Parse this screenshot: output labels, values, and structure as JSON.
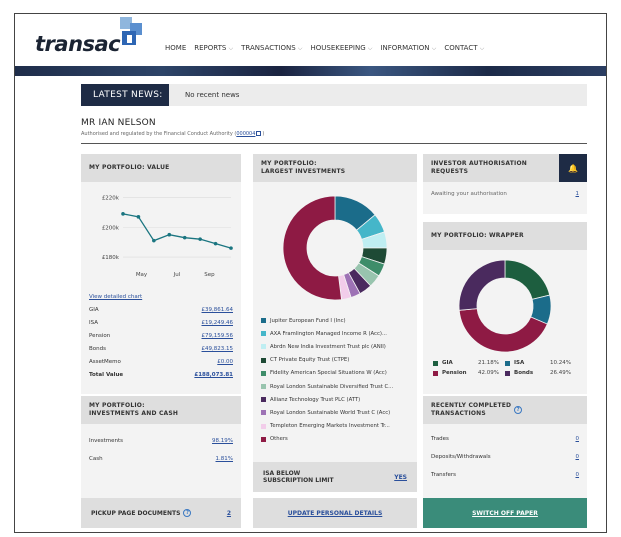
{
  "brand": {
    "logo_text": "transac"
  },
  "nav": [
    {
      "label": "HOME",
      "dropdown": false
    },
    {
      "label": "REPORTS",
      "dropdown": true
    },
    {
      "label": "TRANSACTIONS",
      "dropdown": true
    },
    {
      "label": "HOUSEKEEPING",
      "dropdown": true
    },
    {
      "label": "INFORMATION",
      "dropdown": true
    },
    {
      "label": "CONTACT",
      "dropdown": true
    }
  ],
  "news": {
    "label": "LATEST NEWS:",
    "text": "No recent news"
  },
  "client": {
    "name": "MR IAN NELSON",
    "sub_prefix": "Authorised and regulated by the Financial Conduct Authority (",
    "sub_link": "000004",
    "sub_suffix": ")"
  },
  "value_panel": {
    "title": "MY PORTFOLIO: VALUE",
    "chart_link": "View detailed chart",
    "rows": [
      {
        "label": "GIA",
        "value": "£39,861.64"
      },
      {
        "label": "ISA",
        "value": "£19,249.46"
      },
      {
        "label": "Pension",
        "value": "£79,159.56"
      },
      {
        "label": "Bonds",
        "value": "£49,823.15"
      },
      {
        "label": "AssetMemo",
        "value": "£0.00"
      }
    ],
    "total": {
      "label": "Total Value",
      "value": "£188,073.81"
    }
  },
  "largest_panel": {
    "title_line1": "MY PORTFOLIO:",
    "title_line2": "LARGEST INVESTMENTS",
    "items": [
      {
        "label": "Jupiter European Fund I (Inc)",
        "color": "#1b6c8a"
      },
      {
        "label": "AXA Framlington Managed Income R (Acc)...",
        "color": "#45b6c9"
      },
      {
        "label": "Abrdn New India Investment Trust plc (ANII)",
        "color": "#bfeef2"
      },
      {
        "label": "CT Private Equity Trust (CTPE)",
        "color": "#1e4a35"
      },
      {
        "label": "Fidelity American Special Situations W (Acc)",
        "color": "#3e8d6a"
      },
      {
        "label": "Royal London Sustainable Diversified Trust C...",
        "color": "#98c4ae"
      },
      {
        "label": "Allianz Technology Trust PLC (ATT)",
        "color": "#4a2a5e"
      },
      {
        "label": "Royal London Sustainable World Trust C (Acc)",
        "color": "#9d72b5"
      },
      {
        "label": "Templeton Emerging Markets Investment Tr...",
        "color": "#f2cdea"
      },
      {
        "label": "Others",
        "color": "#8e1a44"
      }
    ]
  },
  "auth_panel": {
    "title_line1": "INVESTOR AUTHORISATION",
    "title_line2": "REQUESTS",
    "row_label": "Awaiting your authorisation",
    "row_value": "1"
  },
  "wrapper_panel": {
    "title": "MY PORTFOLIO: WRAPPER",
    "legend": [
      {
        "name": "GIA",
        "pct": "21.18%"
      },
      {
        "name": "ISA",
        "pct": "10.24%"
      },
      {
        "name": "Pension",
        "pct": "42.09%"
      },
      {
        "name": "Bonds",
        "pct": "26.49%"
      }
    ]
  },
  "invest_cash_panel": {
    "title_line1": "MY PORTFOLIO:",
    "title_line2": "INVESTMENTS AND CASH",
    "rows": [
      {
        "label": "Investments",
        "value": "98.19%"
      },
      {
        "label": "Cash",
        "value": "1.81%"
      }
    ]
  },
  "isa_panel": {
    "title_line1": "ISA BELOW",
    "title_line2": "SUBSCRIPTION LIMIT",
    "value": "YES"
  },
  "recent_panel": {
    "title_line1": "RECENTLY COMPLETED",
    "title_line2": "TRANSACTIONS",
    "rows": [
      {
        "label": "Trades",
        "value": "0"
      },
      {
        "label": "Deposits/Withdrawals",
        "value": "0"
      },
      {
        "label": "Transfers",
        "value": "0"
      }
    ]
  },
  "bottom": {
    "pickup_label": "PICKUP PAGE DOCUMENTS",
    "pickup_value": "2",
    "update_label": "UPDATE PERSONAL DETAILS",
    "paper_label": "SWITCH OFF PAPER"
  },
  "colors": {
    "teal_button": "#3a8c7a",
    "navy": "#1e2b45",
    "link": "#2a4f9b"
  },
  "chart_data": [
    {
      "type": "line",
      "title": "",
      "x": [
        0,
        1,
        2,
        3,
        4,
        5,
        6,
        7
      ],
      "tick_labels": {
        "positions": [
          1.2,
          3.5,
          5.6
        ],
        "labels": [
          "May",
          "Jul",
          "Sep"
        ]
      },
      "series": [
        {
          "values": [
            209,
            207,
            191,
            195,
            193,
            192,
            189,
            186
          ]
        }
      ],
      "yticks": [
        "£220k",
        "£200k",
        "£180k"
      ],
      "ylim": [
        174,
        225
      ],
      "grid": true
    },
    {
      "type": "pie",
      "donut": true,
      "labels": [
        "Jupiter European Fund I (Inc)",
        "AXA Framlington Managed Income R (Acc)...",
        "Abrdn New India Investment Trust plc (ANII)",
        "CT Private Equity Trust (CTPE)",
        "Fidelity American Special Situations W (Acc)",
        "Royal London Sustainable Diversified Trust C...",
        "Allianz Technology Trust PLC (ATT)",
        "Royal London Sustainable World Trust C (Acc)",
        "Templeton Emerging Markets Investment Tr...",
        "Others"
      ],
      "values": [
        14,
        6,
        5,
        5,
        4,
        4,
        4,
        3,
        3,
        52
      ]
    },
    {
      "type": "pie",
      "donut": true,
      "labels": [
        "GIA",
        "ISA",
        "Pension",
        "Bonds"
      ],
      "values": [
        21.18,
        10.24,
        42.09,
        26.49
      ],
      "colors": [
        "#1d5e3f",
        "#1b6c8a",
        "#8e1a44",
        "#4a2a5e"
      ]
    }
  ]
}
